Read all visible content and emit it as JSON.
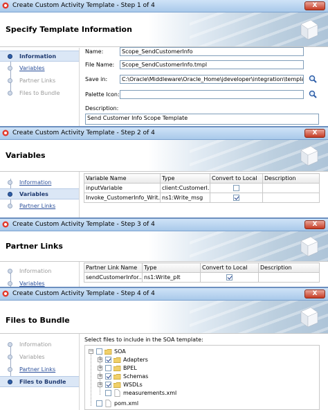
{
  "step1": {
    "title": "Create Custom Activity Template - Step 1 of 4",
    "close": "X",
    "header": "Specify Template Information",
    "nav": [
      "Information",
      "Variables",
      "Partner Links",
      "Files to Bundle"
    ],
    "fields": {
      "name_label": "Name:",
      "name_value": "Scope_SendCustomerInfo",
      "file_label": "File Name:",
      "file_value": "Scope_SendCustomerInfo.tmpl",
      "save_label": "Save in:",
      "save_value": "C:\\Oracle\\Middleware\\Oracle_Home\\jdeveloper\\integration\\templates",
      "palette_label": "Palette Icon:",
      "palette_value": "",
      "desc_label": "Description:",
      "desc_value": "Send Customer Info Scope Template"
    }
  },
  "step2": {
    "title": "Create Custom Activity Template - Step 2 of 4",
    "close": "X",
    "header": "Variables",
    "nav": [
      "Information",
      "Variables",
      "Partner Links"
    ],
    "columns": [
      "Variable Name",
      "Type",
      "Convert to Local",
      "Description"
    ],
    "rows": [
      {
        "name": "inputVariable",
        "type": "client:CustomerI...",
        "checked": false,
        "desc": ""
      },
      {
        "name": "Invoke_CustomerInfo_Writ...",
        "type": "ns1:Write_msg",
        "checked": true,
        "desc": ""
      }
    ]
  },
  "step3": {
    "title": "Create Custom Activity Template - Step 3 of 4",
    "close": "X",
    "header": "Partner Links",
    "nav": [
      "Information",
      "Variables"
    ],
    "columns": [
      "Partner Link Name",
      "Type",
      "Convert to Local",
      "Description"
    ],
    "rows": [
      {
        "name": "sendCustomerInfor...",
        "type": "ns1:Write_plt",
        "checked": true,
        "desc": ""
      }
    ]
  },
  "step4": {
    "title": "Create Custom Activity Template - Step 4 of 4",
    "close": "X",
    "header": "Files to Bundle",
    "nav": [
      "Information",
      "Variables",
      "Partner Links",
      "Files to Bundle"
    ],
    "prompt": "Select files to include in the SOA template:",
    "tree": {
      "root": "SOA",
      "children": [
        {
          "label": "Adapters",
          "checked": true,
          "expandable": true
        },
        {
          "label": "BPEL",
          "checked": false,
          "expandable": true
        },
        {
          "label": "Schemas",
          "checked": true,
          "expandable": true
        },
        {
          "label": "WSDLs",
          "checked": true,
          "expandable": true
        },
        {
          "label": "measurements.xml",
          "checked": false,
          "expandable": false
        }
      ],
      "sibling": {
        "label": "pom.xml",
        "checked": false
      }
    }
  }
}
